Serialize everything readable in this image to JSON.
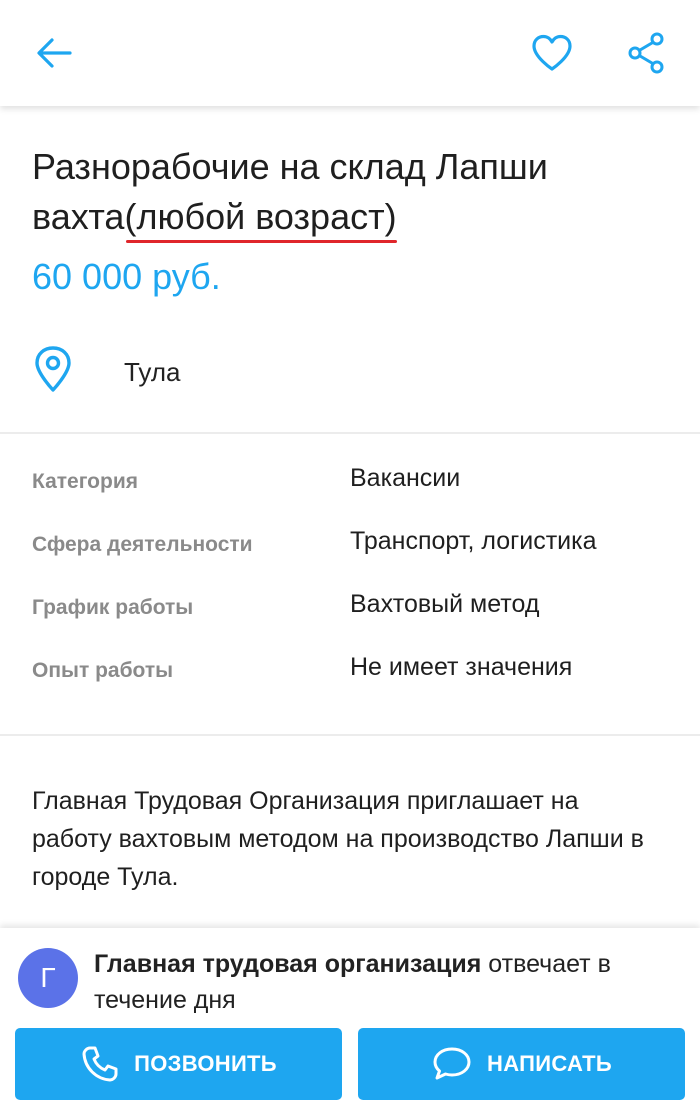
{
  "header": {
    "back_icon": "arrow-left-icon",
    "favorite_icon": "heart-outline-icon",
    "share_icon": "share-icon",
    "accent_color": "#1ea6f0"
  },
  "ad": {
    "title_part1": "Разнорабочие на склад Лапши вахта",
    "title_highlight": "(любой возраст)",
    "highlight_color": "#e0262b",
    "price": "60 000 руб.",
    "location": "Тула"
  },
  "properties": [
    {
      "key": "Категория",
      "value": "Вакансии"
    },
    {
      "key": "Сфера деятельности",
      "value": "Транспорт, логистика"
    },
    {
      "key": "График работы",
      "value": "Вахтовый метод"
    },
    {
      "key": "Опыт работы",
      "value": "Не имеет значения"
    }
  ],
  "description": "Главная Трудовая Организация приглашает на работу вахтовым методом на производство Лапши в городе Тула.",
  "seller": {
    "avatar_letter": "Г",
    "avatar_color": "#5b72e8",
    "name": "Главная трудовая организация",
    "response_time": " отвечает в течение дня"
  },
  "actions": {
    "call_label": "ПОЗВОНИТЬ",
    "message_label": "НАПИСАТЬ",
    "call_icon": "phone-icon",
    "message_icon": "chat-bubble-icon"
  }
}
